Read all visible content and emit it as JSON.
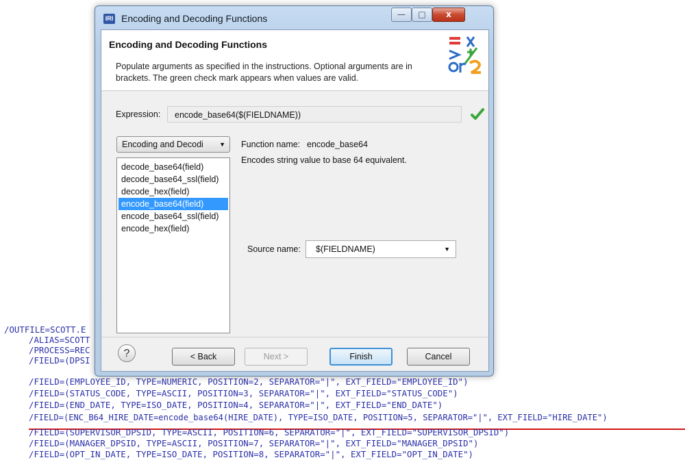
{
  "window": {
    "title": "Encoding and Decoding Functions",
    "app_icon_text": "IRI",
    "buttons": {
      "minimize": "—",
      "maximize": "□",
      "close": "x"
    }
  },
  "header": {
    "title": "Encoding and Decoding Functions",
    "description": "Populate arguments as specified in the instructions. Optional arguments are in brackets. The green check mark appears when values are valid.",
    "logo_icon": "function-symbols-logo"
  },
  "expression": {
    "label": "Expression:",
    "value": "encode_base64($(FIELDNAME))",
    "valid_icon": "green-check-icon",
    "valid_color": "#3aa63a"
  },
  "category": {
    "selected": "Encoding and Decodi",
    "arrow": "▼"
  },
  "functions": {
    "items": [
      "decode_base64(field)",
      "decode_base64_ssl(field)",
      "decode_hex(field)",
      "encode_base64(field)",
      "encode_base64_ssl(field)",
      "encode_hex(field)"
    ],
    "selected_index": 3,
    "selected_color": "#3399ff"
  },
  "details": {
    "function_name_label": "Function name:",
    "function_name": "encode_base64",
    "description": "Encodes string value to base 64 equivalent."
  },
  "source": {
    "label": "Source name:",
    "value": "$(FIELDNAME)",
    "arrow": "▼"
  },
  "footer": {
    "help": "?",
    "back": "< Back",
    "next": "Next >",
    "finish": "Finish",
    "cancel": "Cancel"
  },
  "code": {
    "lines": [
      "/OUTFILE=SCOTT.E",
      "/ALIAS=SCOTT",
      "/PROCESS=REC",
      "/FIELD=(DPSI",
      "/FIELD=(EMPLOYEE_ID, TYPE=NUMERIC, POSITION=2, SEPARATOR=\"|\", EXT_FIELD=\"EMPLOYEE_ID\")",
      "/FIELD=(STATUS_CODE, TYPE=ASCII, POSITION=3, SEPARATOR=\"|\", EXT_FIELD=\"STATUS_CODE\")",
      "/FIELD=(END_DATE, TYPE=ISO_DATE, POSITION=4, SEPARATOR=\"|\", EXT_FIELD=\"END_DATE\")",
      "/FIELD=(ENC_B64_HIRE_DATE=encode_base64(HIRE_DATE), TYPE=ISO_DATE, POSITION=5, SEPARATOR=\"|\", EXT_FIELD=\"HIRE_DATE\")",
      "/FIELD=(SUPERVISOR_DPSID, TYPE=ASCII, POSITION=6, SEPARATOR=\"|\", EXT_FIELD=\"SUPERVISOR_DPSID\")",
      "/FIELD=(MANAGER_DPSID, TYPE=ASCII, POSITION=7, SEPARATOR=\"|\", EXT_FIELD=\"MANAGER_DPSID\")",
      "/FIELD=(OPT_IN_DATE, TYPE=ISO_DATE, POSITION=8, SEPARATOR=\"|\", EXT_FIELD=\"OPT_IN_DATE\")"
    ],
    "highlighted_line_index": 7,
    "highlight_color": "#d01515"
  }
}
